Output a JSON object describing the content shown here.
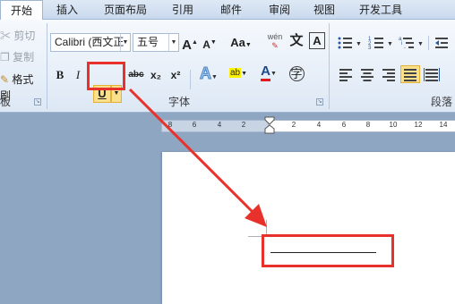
{
  "tabs": [
    {
      "label": "开始",
      "active": true
    },
    {
      "label": "插入"
    },
    {
      "label": "页面布局"
    },
    {
      "label": "引用"
    },
    {
      "label": "邮件"
    },
    {
      "label": "审阅"
    },
    {
      "label": "视图"
    },
    {
      "label": "开发工具"
    }
  ],
  "clipboard": {
    "cut": "剪切",
    "copy": "复制",
    "format_painter": "格式刷",
    "label_fragment": "板"
  },
  "font": {
    "font_name": "Calibri (西文正",
    "font_size": "五号",
    "label": "字体",
    "underline_glyph": "U",
    "bold_glyph": "B",
    "italic_glyph": "I",
    "strike_glyph": "abc",
    "sub_glyph": "x₂",
    "sup_glyph": "x²",
    "grow_glyph": "A",
    "shrink_glyph": "A",
    "case_glyph": "Aa",
    "phonetic_glyph": "wén",
    "char_border_glyph": "A",
    "enclose_glyph": "字",
    "pinyin_glyph": "文",
    "highlight_glyph": "ab",
    "font_color_glyph": "A"
  },
  "paragraph": {
    "label": "段落"
  },
  "ruler": {
    "numbers": [
      "8",
      "6",
      "4",
      "2",
      "2",
      "4",
      "6",
      "8",
      "10",
      "12",
      "14"
    ]
  },
  "colors": {
    "annotation": "#e8312a",
    "highlight_yellow": "#fbe08b",
    "font_color_red": "#e01b1b"
  }
}
